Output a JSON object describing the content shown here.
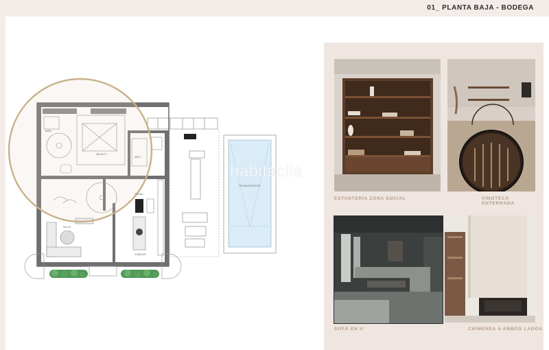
{
  "header": {
    "title": "01_ PLANTA BAJA - BODEGA"
  },
  "floorplan": {
    "room_labels": [
      "BAÑO",
      "SALON TV",
      "COMEDOR",
      "COCINA",
      "SALON",
      "ASEO",
      "PISCINA"
    ],
    "pool_label": "PISCINA EXISTENTE"
  },
  "watermark": "habitaclia",
  "gallery": [
    {
      "caption": "ESTANTERÍA ZONA SOCIAL"
    },
    {
      "caption": "VINOTECA ENTERRADA"
    },
    {
      "caption": "SOFÁ EN U"
    },
    {
      "caption": "CHIMENEA A AMBOS LADOS"
    }
  ],
  "colors": {
    "accent": "#c9b08a",
    "caption": "#b39a86",
    "pool": "#d9ecf7",
    "panel": "#efe6e1"
  }
}
